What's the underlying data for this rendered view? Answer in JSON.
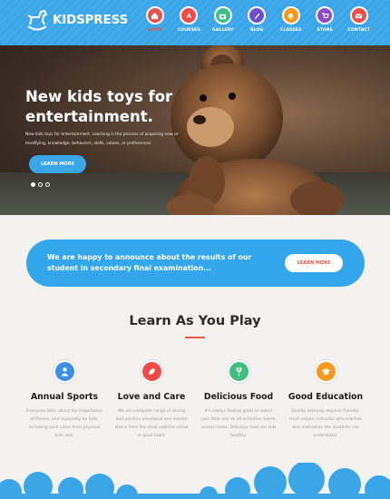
{
  "brand": {
    "name": "KIDSPRESS"
  },
  "nav": [
    {
      "label": "HOME",
      "icon": "home-icon",
      "color": "#ef4e48",
      "active": true
    },
    {
      "label": "COURSES",
      "icon": "rocket-icon",
      "color": "#ef4e48"
    },
    {
      "label": "GALLERY",
      "icon": "camera-icon",
      "color": "#3cbf82"
    },
    {
      "label": "BLOG",
      "icon": "pencil-icon",
      "color": "#6b4fcf"
    },
    {
      "label": "CLASSES",
      "icon": "bell-icon",
      "color": "#f39a1e"
    },
    {
      "label": "STORE",
      "icon": "cart-icon",
      "color": "#8d4bc6"
    },
    {
      "label": "CONTACT",
      "icon": "mail-icon",
      "color": "#ef4e48"
    }
  ],
  "hero": {
    "title": "New kids toys for entertainment.",
    "text": "New kids toys for entertainment. Learning is the process of acquiring new or modifying, knowledge, behaviors, skills, values, or preferences.",
    "button": "LEARN MORE",
    "slides": 3,
    "active_slide": 1
  },
  "announcement": {
    "text": "We are happy to announce about the results of our student in secondary final examination...",
    "button": "LEARN MORE"
  },
  "section": {
    "title": "Learn As You Play"
  },
  "features": [
    {
      "title": "Annual Sports",
      "icon": "person-icon",
      "color": "#3a8fe6",
      "text": "Everyone talks about the importance of fitness, and especially for kids, including such value from physical kids and."
    },
    {
      "title": "Love and Care",
      "icon": "leaf-icon",
      "color": "#ef4b4b",
      "text": "We are complete range of strong and positive emotional and mental states from the most sublime virtue or good habit."
    },
    {
      "title": "Delicious Food",
      "icon": "fork-icon",
      "color": "#3dbf7d",
      "text": "It's always feeling great to watch your little one do all activities, home, school meals. Delicious food are kids healthy."
    },
    {
      "title": "Good Education",
      "icon": "graduation-cap-icon",
      "color": "#f39a1e",
      "text": "Quality learning requires friendly, trust values instructor who teaches and motivation the students can understand."
    }
  ]
}
